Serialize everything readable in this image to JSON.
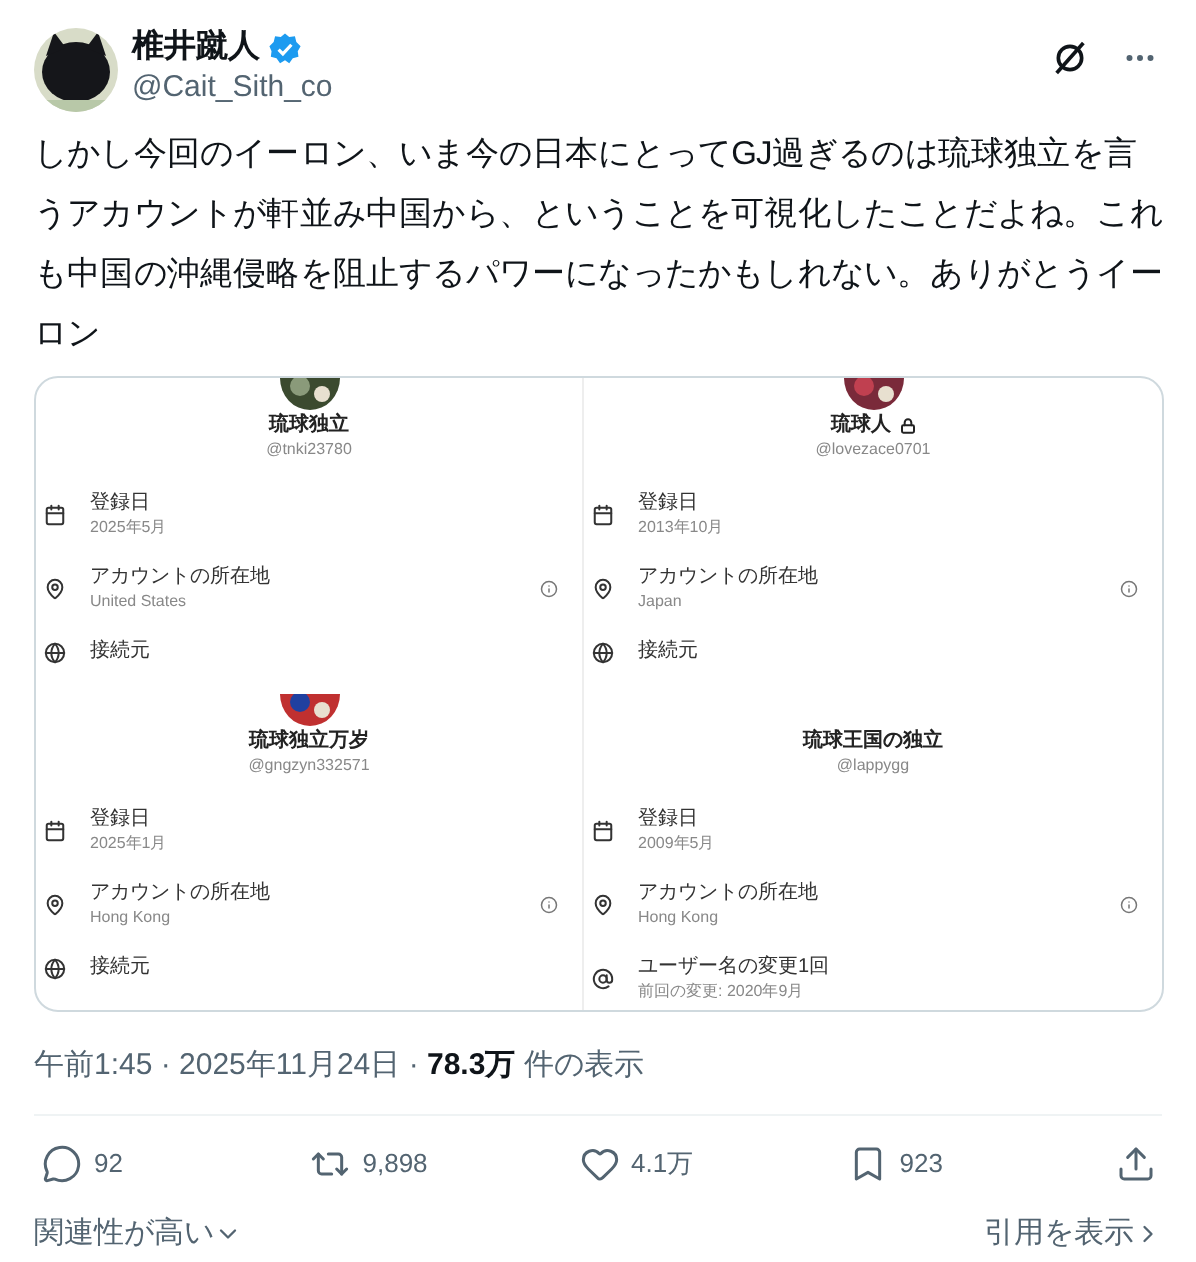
{
  "author": {
    "name": "椎井蹴人",
    "verified": true,
    "handle": "@Cait_Sith_co"
  },
  "text": "しかし今回のイーロン、いま今の日本にとってGJ過ぎるのは琉球独立を言うアカウントが軒並み中国から、ということを可視化したことだよね。これも中国の沖縄侵略を阻止するパワーになったかもしれない。ありがとうイーロン",
  "image": {
    "panels": [
      {
        "name": "琉球独立",
        "locked": false,
        "handle": "@tnki23780",
        "rows": [
          {
            "kind": "joined",
            "label": "登録日",
            "value": "2025年5月",
            "info": false
          },
          {
            "kind": "location",
            "label": "アカウントの所在地",
            "value": "United States",
            "info": true
          },
          {
            "kind": "connection",
            "label": "接続元",
            "info": false
          }
        ]
      },
      {
        "name": "琉球人",
        "locked": true,
        "handle": "@lovezace0701",
        "rows": [
          {
            "kind": "joined",
            "label": "登録日",
            "value": "2013年10月",
            "info": false
          },
          {
            "kind": "location",
            "label": "アカウントの所在地",
            "value": "Japan",
            "info": true
          },
          {
            "kind": "connection",
            "label": "接続元",
            "info": false
          }
        ]
      },
      {
        "name": "琉球独立万岁",
        "locked": false,
        "handle": "@gngzyn332571",
        "rows": [
          {
            "kind": "joined",
            "label": "登録日",
            "value": "2025年1月",
            "info": false
          },
          {
            "kind": "location",
            "label": "アカウントの所在地",
            "value": "Hong Kong",
            "info": true
          },
          {
            "kind": "connection",
            "label": "接続元",
            "info": false
          }
        ]
      },
      {
        "name": "琉球王国の独立",
        "locked": false,
        "handle": "@lappygg",
        "rows": [
          {
            "kind": "joined",
            "label": "登録日",
            "value": "2009年5月",
            "info": false
          },
          {
            "kind": "location",
            "label": "アカウントの所在地",
            "value": "Hong Kong",
            "info": true
          },
          {
            "kind": "username",
            "label": "ユーザー名の変更1回",
            "value": "前回の変更: 2020年9月",
            "info": false
          }
        ]
      }
    ]
  },
  "meta": {
    "time": "午前1:45 · 2025年11月24日 · ",
    "views": "78.3万",
    "views_label": "件の表示"
  },
  "actions": [
    {
      "kind": "reply",
      "count": "92"
    },
    {
      "kind": "repost",
      "count": "9,898"
    },
    {
      "kind": "like",
      "count": "4.1万"
    },
    {
      "kind": "bookmark",
      "count": "923"
    },
    {
      "kind": "share"
    }
  ],
  "sort": "関連性が高い",
  "quotes": "引用を表示"
}
